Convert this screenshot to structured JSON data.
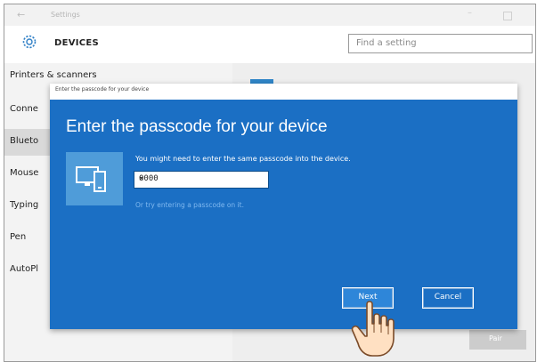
{
  "window": {
    "title": "Settings",
    "back_icon": "←",
    "min_icon": "–"
  },
  "header": {
    "section": "DEVICES",
    "search_placeholder": "Find a setting"
  },
  "sidebar": {
    "items": [
      {
        "label": "Printers & scanners"
      },
      {
        "label": "Conne"
      },
      {
        "label": "Blueto"
      },
      {
        "label": "Mouse"
      },
      {
        "label": "Typing"
      },
      {
        "label": "Pen"
      },
      {
        "label": "AutoPl"
      }
    ],
    "active_index": 2
  },
  "content": {
    "pair_label": "Pair"
  },
  "dialog": {
    "window_title": "Enter the passcode for your device",
    "heading": "Enter the passcode for your device",
    "instruction": "You might need to enter the same passcode into the device.",
    "passcode_value": "0000",
    "clear_icon": "✕",
    "alt_link": "Or try entering a passcode on it.",
    "next_label": "Next",
    "cancel_label": "Cancel"
  },
  "colors": {
    "accent": "#1b6fc4",
    "link": "#7fb8ef"
  }
}
